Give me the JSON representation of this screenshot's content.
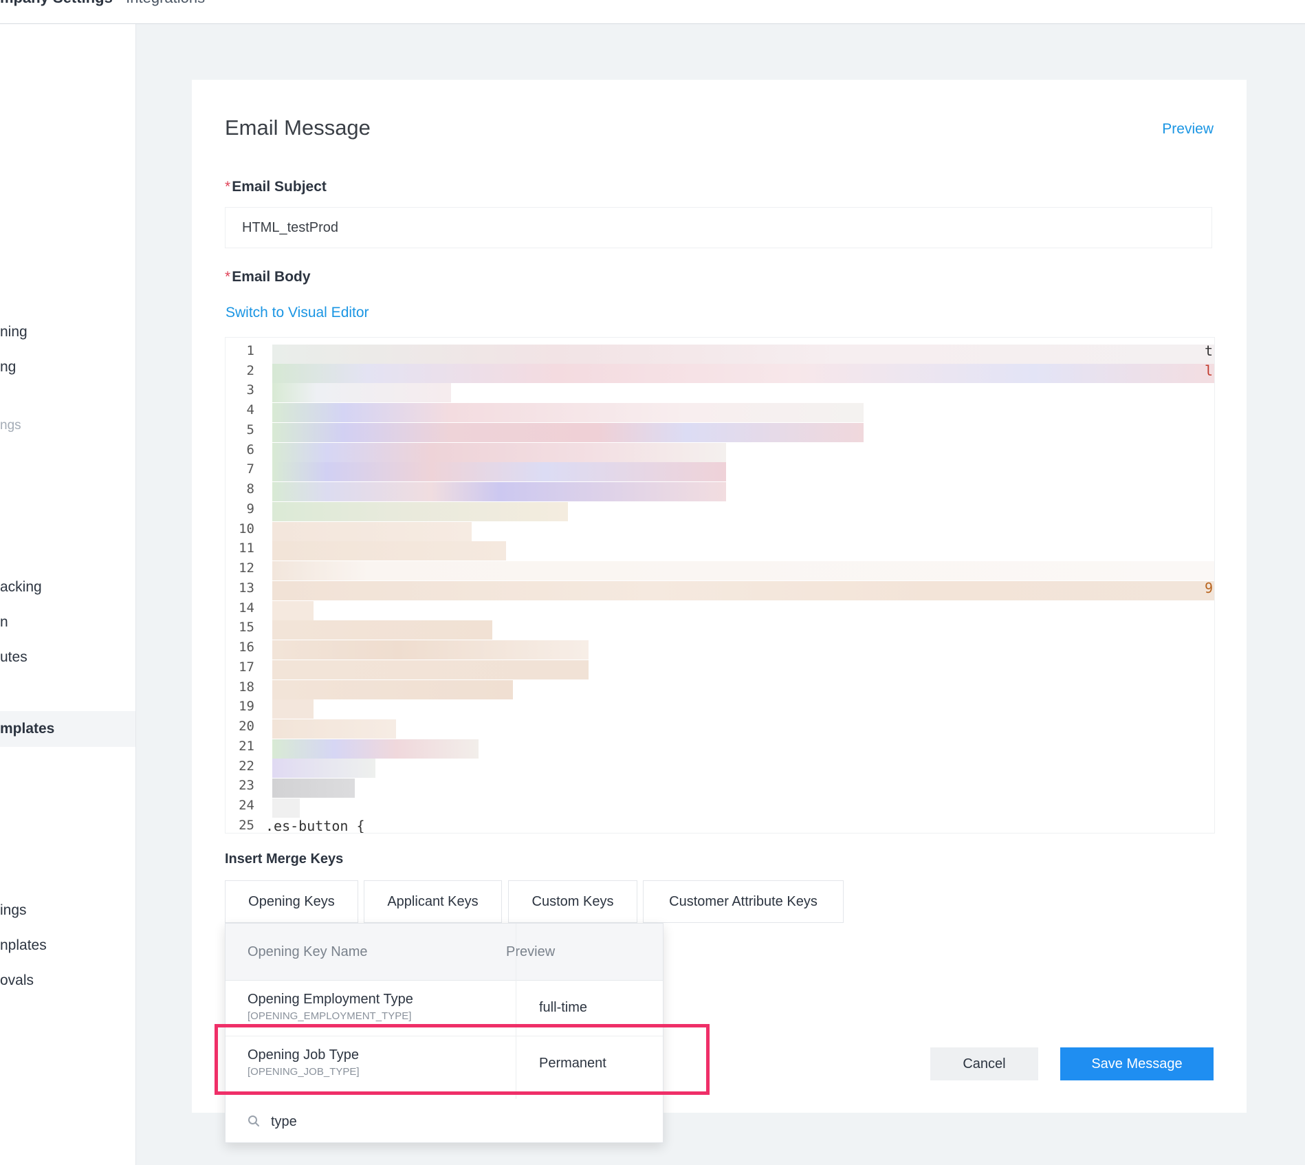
{
  "breadcrumb": {
    "first": "mpany Settings",
    "separator": "·",
    "last": "Integrations"
  },
  "sidebar": {
    "items": [
      "ning",
      "ng",
      "ngs",
      "acking",
      "n",
      "utes",
      "mplates",
      "ings",
      "nplates",
      "ovals"
    ]
  },
  "email": {
    "title": "Email Message",
    "preview_link": "Preview",
    "subject_label": "Email Subject",
    "required_mark": "*",
    "subject_value": "HTML_testProd",
    "body_label": "Email Body",
    "switch_link": "Switch to Visual Editor",
    "code": {
      "line_numbers": [
        "1",
        "2",
        "3",
        "4",
        "5",
        "6",
        "7",
        "8",
        "9",
        "10",
        "11",
        "12",
        "13",
        "14",
        "15",
        "16",
        "17",
        "18",
        "19",
        "20",
        "21",
        "22",
        "23",
        "24",
        "25"
      ],
      "visible_line_25": ".es-button {",
      "edge_chars": [
        "t",
        "l",
        "9"
      ]
    }
  },
  "merge_keys": {
    "label": "Insert Merge Keys",
    "tabs": [
      "Opening Keys",
      "Applicant Keys",
      "Custom Keys",
      "Customer Attribute Keys"
    ],
    "table_headers": {
      "name": "Opening Key Name",
      "preview": "Preview"
    },
    "rows": [
      {
        "name": "Opening Employment Type",
        "key": "[OPENING_EMPLOYMENT_TYPE]",
        "preview": "full-time"
      },
      {
        "name": "Opening Job Type",
        "key": "[OPENING_JOB_TYPE]",
        "preview": "Permanent"
      }
    ],
    "search_value": "type"
  },
  "actions": {
    "cancel": "Cancel",
    "save": "Save Message"
  },
  "colors": {
    "accent": "#1a95e3",
    "primary_button": "#1f8ef1",
    "highlight": "#ef2f68",
    "required": "#e0445a"
  }
}
